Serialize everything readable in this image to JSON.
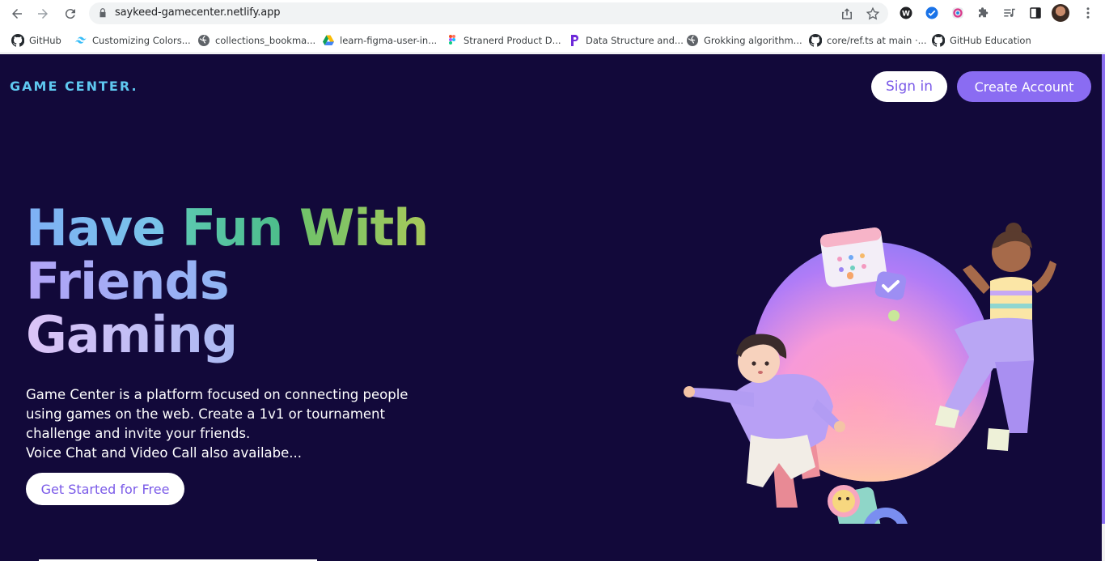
{
  "browser": {
    "url": "saykeed-gamecenter.netlify.app",
    "bookmarks": [
      {
        "label": "GitHub",
        "icon": "github-icon"
      },
      {
        "label": "Customizing Colors...",
        "icon": "tailwind-icon"
      },
      {
        "label": "collections_bookma...",
        "icon": "globe-icon"
      },
      {
        "label": "learn-figma-user-in...",
        "icon": "google-drive-icon"
      },
      {
        "label": "Stranerd Product D...",
        "icon": "figma-icon"
      },
      {
        "label": "Data Structure and...",
        "icon": "p-logo-icon"
      },
      {
        "label": "Grokking algorithm...",
        "icon": "globe-icon"
      },
      {
        "label": "core/ref.ts at main ·...",
        "icon": "github-icon"
      },
      {
        "label": "GitHub Education",
        "icon": "github-icon"
      }
    ]
  },
  "header": {
    "logo": "GAME CENTER.",
    "signin_label": "Sign in",
    "create_label": "Create Account"
  },
  "hero": {
    "title_have": "Have",
    "title_fun": "Fun",
    "title_with": "With",
    "title_friends": "Friends",
    "title_gaming": "Gaming",
    "desc_lines": [
      "Game Center is a platform focused on connecting people",
      "using games on the web. Create a 1v1 or tournament",
      "challenge and invite your friends.",
      "Voice Chat and Video Call also availabe..."
    ],
    "cta_label": "Get Started for Free"
  },
  "colors": {
    "page_bg": "#12093a",
    "accent": "#8a6cf2",
    "logo": "#5fc8f0"
  }
}
